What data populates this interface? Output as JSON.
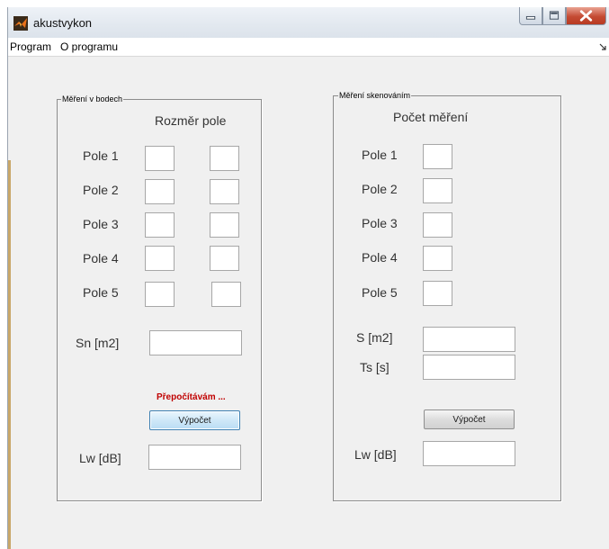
{
  "window": {
    "title": "akustvykon",
    "controls": {
      "minimize": "minimize",
      "maximize": "maximize",
      "close": "close"
    }
  },
  "menu": {
    "items": [
      "Program",
      "O programu"
    ]
  },
  "points_panel": {
    "title": "Měření v bodech",
    "header": "Rozměr pole",
    "rows": [
      {
        "label": "Pole 1",
        "values": [
          "",
          ""
        ]
      },
      {
        "label": "Pole 2",
        "values": [
          "",
          ""
        ]
      },
      {
        "label": "Pole 3",
        "values": [
          "",
          ""
        ]
      },
      {
        "label": "Pole 4",
        "values": [
          "",
          ""
        ]
      },
      {
        "label": "Pole 5",
        "values": [
          "",
          ""
        ]
      }
    ],
    "sn_label": "Sn [m2]",
    "sn_value": "",
    "status": "Přepočítávám ...",
    "button": "Výpočet",
    "lw_label": "Lw [dB]",
    "lw_value": ""
  },
  "scan_panel": {
    "title": "Měření skenováním",
    "header": "Počet  měření",
    "rows": [
      {
        "label": "Pole 1",
        "value": ""
      },
      {
        "label": "Pole 2",
        "value": ""
      },
      {
        "label": "Pole 3",
        "value": ""
      },
      {
        "label": "Pole 4",
        "value": ""
      },
      {
        "label": "Pole 5",
        "value": ""
      }
    ],
    "s_label": "S [m2]",
    "s_value": "",
    "ts_label": "Ts [s]",
    "ts_value": "",
    "button": "Výpočet",
    "lw_label": "Lw [dB]",
    "lw_value": ""
  }
}
